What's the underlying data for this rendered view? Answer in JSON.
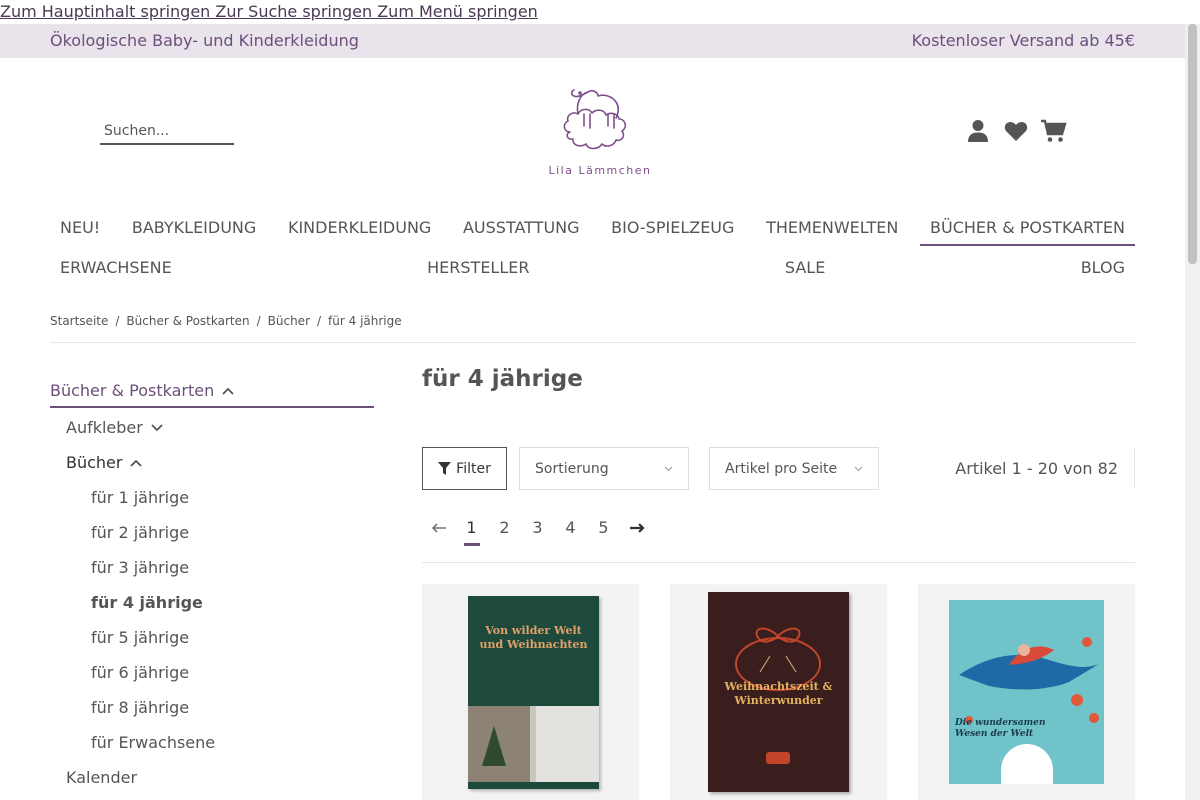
{
  "skip_links": {
    "text": "Zum Hauptinhalt springen Zur Suche springen Zum Menü springen"
  },
  "topbar": {
    "left": "Ökologische Baby- und Kinderkleidung",
    "right": "Kostenloser Versand ab 45€"
  },
  "search": {
    "placeholder": "Suchen..."
  },
  "logo": {
    "text": "Lila Lämmchen"
  },
  "nav": {
    "row1": [
      "NEU!",
      "BABYKLEIDUNG",
      "KINDERKLEIDUNG",
      "AUSSTATTUNG",
      "BIO-SPIELZEUG",
      "THEMENWELTEN",
      "BÜCHER & POSTKARTEN"
    ],
    "row2": [
      "ERWACHSENE",
      "HERSTELLER",
      "SALE",
      "BLOG"
    ]
  },
  "breadcrumb": [
    "Startseite",
    "Bücher & Postkarten",
    "Bücher",
    "für 4 jährige"
  ],
  "sidebar": {
    "head": "Bücher & Postkarten",
    "aufkleber": "Aufkleber",
    "buecher": "Bücher",
    "items": [
      "für 1 jährige",
      "für 2 jährige",
      "für 3 jährige",
      "für 4 jährige",
      "für 5 jährige",
      "für 6 jährige",
      "für 8 jährige",
      "für Erwachsene"
    ],
    "kalender": "Kalender"
  },
  "content": {
    "title": "für 4 jährige",
    "filter": "Filter",
    "sort": "Sortierung",
    "per_page": "Artikel pro Seite",
    "count": "Artikel 1 - 20 von 82",
    "pages": [
      "1",
      "2",
      "3",
      "4",
      "5"
    ]
  },
  "products": [
    {
      "title": "Von wilder Welt und Weihnachten"
    },
    {
      "title": "Weihnachtszeit & Winterwunder"
    },
    {
      "title": "Die wundersamen Wesen der Welt"
    }
  ],
  "colors": {
    "accent": "#6c4f7a",
    "topbar_bg": "#e9e4ec"
  }
}
